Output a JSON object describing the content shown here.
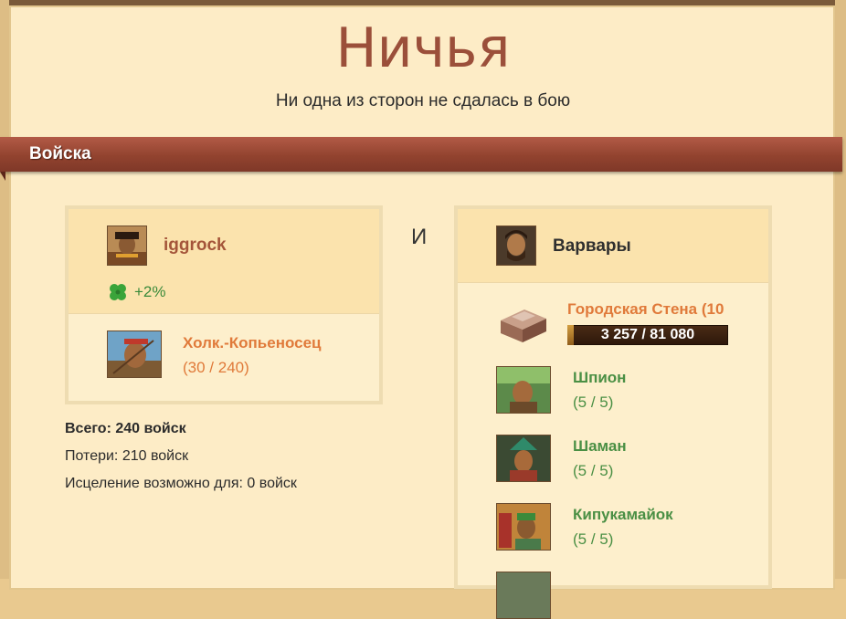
{
  "header": {
    "title": "Ничья",
    "subtitle": "Ни одна из сторон не сдалась в бою"
  },
  "section": {
    "label": "Войска"
  },
  "separator": "И",
  "player": {
    "name": "iggrock",
    "luck": "+2%",
    "units": [
      {
        "name": "Холк.-Копьеносец",
        "count": "(30 / 240)",
        "icon": "spearman-portrait"
      }
    ],
    "totals": {
      "total": "Всего: 240 войск",
      "losses": "Потери: 210 войск",
      "healing": "Исцеление возможно для: 0 войск"
    }
  },
  "enemy": {
    "name": "Варвары",
    "wall": {
      "name": "Городская Стена (10",
      "hp_text": "3 257 / 81 080",
      "hp_fraction": 0.04
    },
    "units": [
      {
        "name": "Шпион",
        "count": "(5 / 5)",
        "icon": "spy-portrait"
      },
      {
        "name": "Шаман",
        "count": "(5 / 5)",
        "icon": "shaman-portrait"
      },
      {
        "name": "Кипукамайок",
        "count": "(5 / 5)",
        "icon": "quipucamayoc-portrait"
      }
    ]
  },
  "colors": {
    "title": "#9b4f3a",
    "banner": "#92432f",
    "player_name": "#a4553a",
    "unit_orange": "#e07a3a",
    "unit_green": "#4a8f44",
    "panel_bg": "#fdecc6"
  }
}
